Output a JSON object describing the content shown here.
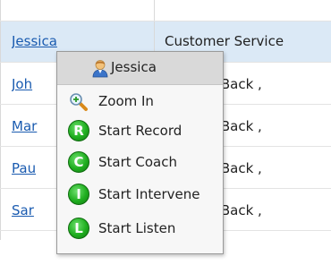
{
  "table": {
    "rows": [
      {
        "name": "Jessica",
        "skill": "Customer Service",
        "selected": true
      },
      {
        "name": "Joh",
        "skill": "sive CallBack ,"
      },
      {
        "name": "Mar",
        "skill": "sive CallBack ,"
      },
      {
        "name": "Pau",
        "skill": "sive CallBack ,"
      },
      {
        "name": "Sar",
        "skill": "sive CallBack ,"
      }
    ]
  },
  "context_menu": {
    "header": {
      "title": "Jessica",
      "icon": "user-avatar-icon"
    },
    "items": [
      {
        "label": "Zoom In",
        "icon": "magnifier-icon"
      },
      {
        "label": "Start Record",
        "icon": "record-icon",
        "glyph": "R"
      },
      {
        "label": "Start Coach",
        "icon": "coach-icon",
        "glyph": "C"
      },
      {
        "label": "Start Intervene",
        "icon": "intervene-icon",
        "glyph": "I"
      },
      {
        "label": "Start Listen",
        "icon": "listen-icon",
        "glyph": "L"
      }
    ]
  },
  "colors": {
    "selected_row": "#dbe9f6",
    "link": "#1a5bb0",
    "icon_green": "#1fae1f"
  }
}
